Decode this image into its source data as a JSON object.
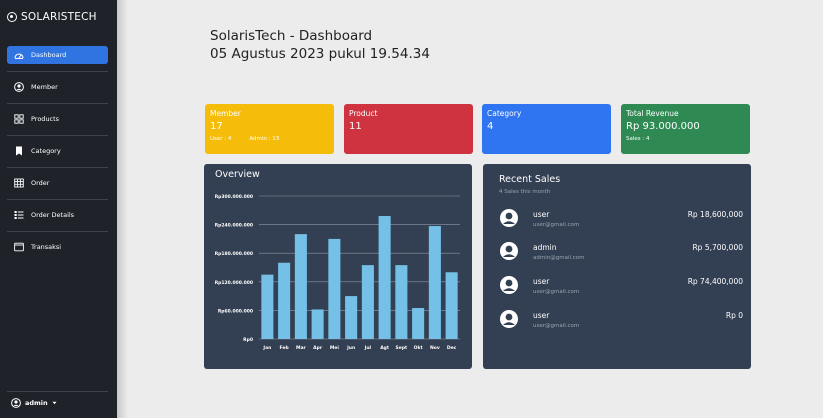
{
  "brand": {
    "name": "SOLARISTECH"
  },
  "sidebar": {
    "items": [
      {
        "label": "Dashboard",
        "icon": "dashboard-icon",
        "active": true
      },
      {
        "label": "Member",
        "icon": "user-circle-icon"
      },
      {
        "label": "Products",
        "icon": "grid-icon"
      },
      {
        "label": "Category",
        "icon": "bookmark-icon"
      },
      {
        "label": "Order",
        "icon": "table-icon"
      },
      {
        "label": "Order Details",
        "icon": "list-icon"
      },
      {
        "label": "Transaksi",
        "icon": "window-icon"
      }
    ],
    "user": "admin"
  },
  "header": {
    "title": "SolarisTech - Dashboard",
    "datetime": "05 Agustus 2023 pukul 19.54.34"
  },
  "cards": [
    {
      "label": "Member",
      "value": "17",
      "sub1": "User : 4",
      "sub2": "Admin : 13",
      "color": "#f5bd0a"
    },
    {
      "label": "Product",
      "value": "11",
      "color": "#d03340"
    },
    {
      "label": "Category",
      "value": "4",
      "color": "#2f74f0"
    },
    {
      "label": "Total Revenue",
      "value": "Rp 93.000.000",
      "sub1": "Sales : 4",
      "color": "#2e8a52"
    }
  ],
  "overview": {
    "title": "Overview"
  },
  "chart_data": {
    "type": "bar",
    "categories": [
      "Jan",
      "Feb",
      "Mar",
      "Apr",
      "Mei",
      "Jun",
      "Jul",
      "Agt",
      "Sept",
      "Okt",
      "Nov",
      "Dec"
    ],
    "values": [
      135000000,
      160000000,
      220000000,
      62000000,
      210000000,
      90000000,
      155000000,
      258000000,
      155000000,
      65000000,
      237000000,
      140000000
    ],
    "yticks": [
      "Rp0",
      "Rp60.000.000",
      "Rp120.000.000",
      "Rp180.000.000",
      "Rp240.000.000",
      "Rp300.000.000"
    ],
    "ylim": [
      0,
      300000000
    ],
    "bar_color": "#74c0e6",
    "grid": true
  },
  "recent_sales": {
    "title": "Recent Sales",
    "subtitle": "4 Sales this month",
    "items": [
      {
        "name": "user",
        "email": "user@gmail.com",
        "amount": "Rp 18,600,000"
      },
      {
        "name": "admin",
        "email": "admin@gmail.com",
        "amount": "Rp 5,700,000"
      },
      {
        "name": "user",
        "email": "user@gmail.com",
        "amount": "Rp 74,400,000"
      },
      {
        "name": "user",
        "email": "user@gmail.com",
        "amount": "Rp 0"
      }
    ]
  }
}
